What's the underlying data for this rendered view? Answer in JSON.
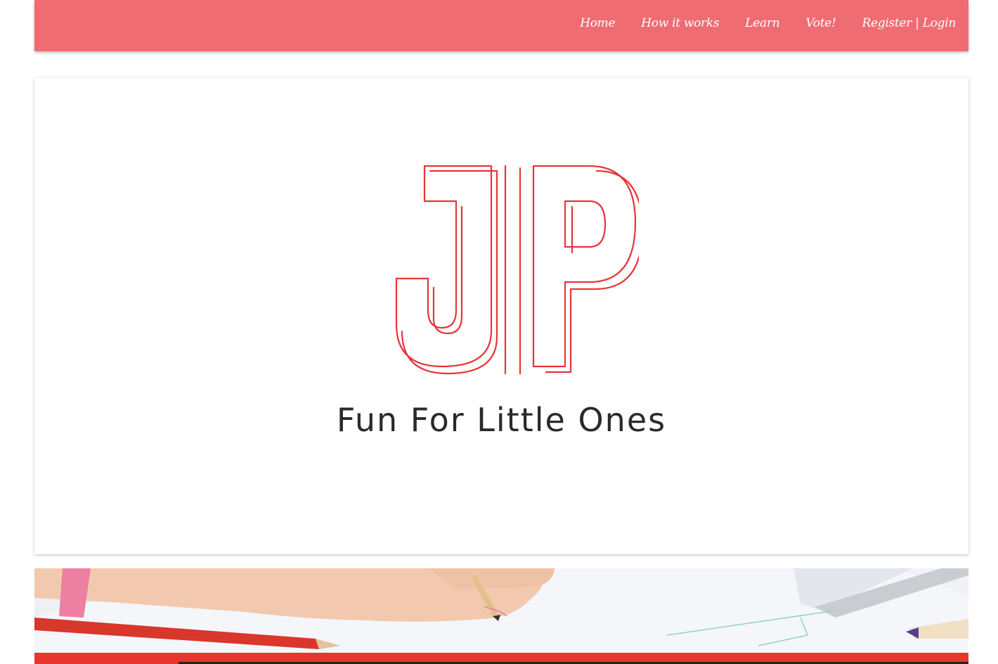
{
  "nav": {
    "items": [
      {
        "label": "Home"
      },
      {
        "label": "How it works"
      },
      {
        "label": "Learn"
      },
      {
        "label": "Vote!"
      },
      {
        "label": "Register | Login"
      }
    ]
  },
  "hero": {
    "logo_letters": "JP",
    "tagline": "Fun For Little Ones"
  },
  "colors": {
    "navbar": "#ee6c72",
    "logo_stroke": "#e8343a",
    "accent_bar": "#e8352e"
  },
  "banner": {
    "image": "child-drawing-with-pencils-photo"
  }
}
